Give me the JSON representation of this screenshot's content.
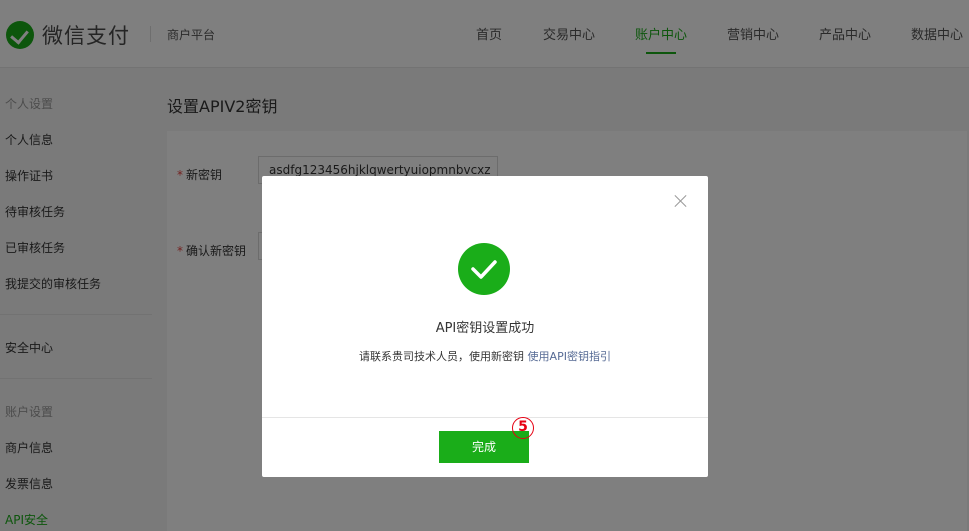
{
  "header": {
    "logo_text": "微信支付",
    "platform": "商户平台",
    "nav": [
      {
        "label": "首页"
      },
      {
        "label": "交易中心"
      },
      {
        "label": "账户中心"
      },
      {
        "label": "营销中心"
      },
      {
        "label": "产品中心"
      },
      {
        "label": "数据中心"
      }
    ],
    "active_nav": "账户中心"
  },
  "sidebar": {
    "items": [
      {
        "label": "个人设置",
        "type": "group"
      },
      {
        "label": "个人信息"
      },
      {
        "label": "操作证书"
      },
      {
        "label": "待审核任务"
      },
      {
        "label": "已审核任务"
      },
      {
        "label": "我提交的审核任务"
      },
      {
        "label": "安全中心"
      },
      {
        "label": "账户设置",
        "type": "group"
      },
      {
        "label": "商户信息"
      },
      {
        "label": "发票信息"
      },
      {
        "label": "API安全",
        "active": true
      }
    ]
  },
  "main": {
    "title": "设置APIV2密钥",
    "form": {
      "new_key_label": "新密钥",
      "new_key_value": "asdfg123456hjklqwertyuiopmnbvcxz",
      "confirm_key_label": "确认新密钥"
    }
  },
  "modal": {
    "title": "API密钥设置成功",
    "desc": "请联系贵司技术人员，使用新密钥",
    "link": "使用API密钥指引",
    "confirm_label": "完成",
    "step_marker": "5"
  },
  "colors": {
    "brand": "#1aad19",
    "link": "#576b95",
    "marker": "#e60012"
  }
}
